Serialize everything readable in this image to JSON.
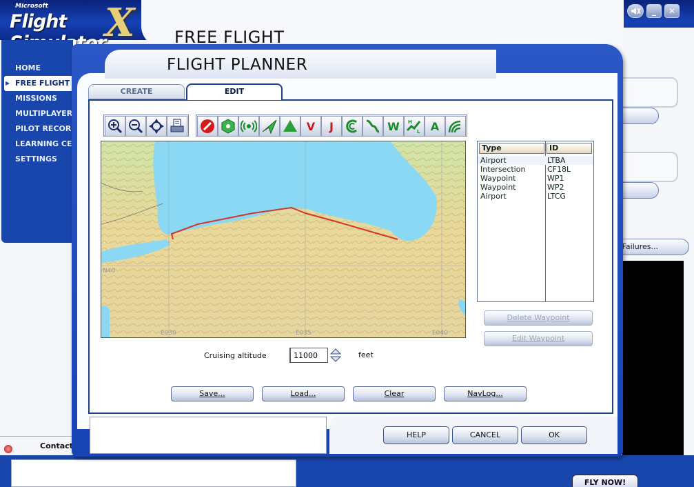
{
  "app": {
    "logo_brand": "Microsoft",
    "logo_title": "Flight Simulator",
    "logo_x": "X",
    "page_title": "FREE FLIGHT",
    "window_controls": {
      "sound": "sound-off-icon",
      "minimize": "_",
      "close": "✕"
    }
  },
  "sidebar": {
    "items": [
      {
        "label": "HOME"
      },
      {
        "label": "FREE FLIGHT"
      },
      {
        "label": "MISSIONS"
      },
      {
        "label": "MULTIPLAYER"
      },
      {
        "label": "PILOT RECORDS"
      },
      {
        "label": "LEARNING CENTER"
      },
      {
        "label": "SETTINGS"
      }
    ],
    "active_index": 1
  },
  "background": {
    "change_button_1": "...",
    "change_button_2": "...",
    "failures_button": "Failures...",
    "contacts_label": "Contacts",
    "fly_now": "FLY NOW!"
  },
  "dialog": {
    "title": "FLIGHT PLANNER",
    "tabs": [
      {
        "label": "CREATE"
      },
      {
        "label": "EDIT"
      }
    ],
    "active_tab": 1,
    "toolbar_icons": [
      "zoom-in-icon",
      "zoom-out-icon",
      "center-icon",
      "print-icon",
      "no-airport-icon",
      "vor-icon",
      "ndb-icon",
      "airway-icon",
      "tower-icon",
      "v-airway-icon",
      "j-airway-icon",
      "ils-icon",
      "approach-icon",
      "waypoint-icon",
      "high-low-icon",
      "airspace-icon",
      "terrain-icon"
    ],
    "toolbar_letters": {
      "v": "V",
      "j": "J",
      "w": "W",
      "a": "A"
    },
    "map": {
      "route_color": "#d4342c",
      "sea_color": "#8ad8f4",
      "lat_label_1": "N40",
      "lon_label_1": "E030",
      "lon_label_2": "E035",
      "lon_label_3": "E040"
    },
    "waypoints": {
      "headers": {
        "type": "Type",
        "id": "ID"
      },
      "rows": [
        {
          "type": "Airport",
          "id": "LTBA"
        },
        {
          "type": "Intersection",
          "id": "CF18L"
        },
        {
          "type": "Waypoint",
          "id": "WP1"
        },
        {
          "type": "Waypoint",
          "id": "WP2"
        },
        {
          "type": "Airport",
          "id": "LTCG"
        }
      ]
    },
    "delete_waypoint": "Delete Waypoint",
    "edit_waypoint": "Edit Waypoint",
    "cruising_altitude_label": "Cruising altitude",
    "cruising_altitude_value": "11000",
    "altitude_unit": "feet",
    "buttons": {
      "save": "Save...",
      "load": "Load...",
      "clear": "Clear",
      "navlog": "NavLog...",
      "help": "HELP",
      "cancel": "CANCEL",
      "ok": "OK"
    }
  }
}
